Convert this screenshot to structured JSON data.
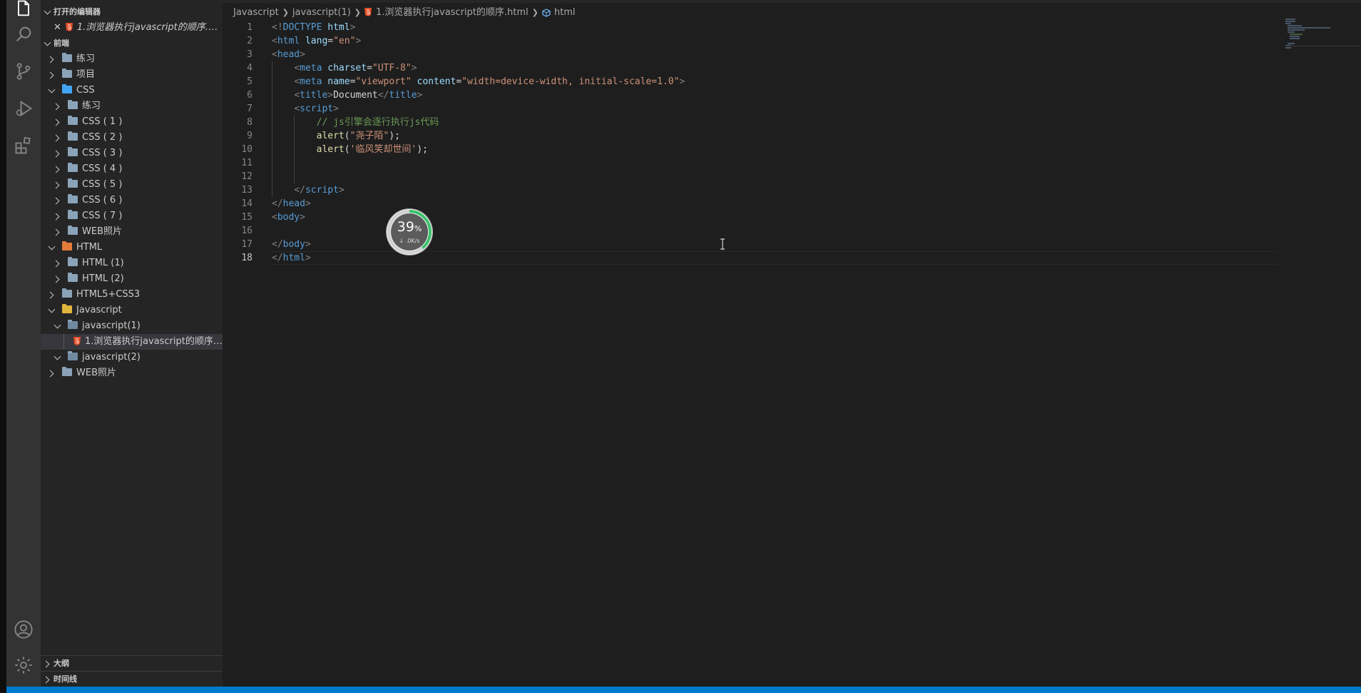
{
  "sidebar": {
    "open_editors_header": "打开的编辑器",
    "open_editor_file": "1.浏览器执行javascript的顺序.html",
    "workspace_header": "前端",
    "tree": [
      {
        "label": "练习",
        "depth": 0,
        "expanded": false,
        "kind": "folder"
      },
      {
        "label": "项目",
        "depth": 0,
        "expanded": false,
        "kind": "folder"
      },
      {
        "label": "CSS",
        "depth": 0,
        "expanded": true,
        "kind": "css"
      },
      {
        "label": "练习",
        "depth": 1,
        "expanded": false,
        "kind": "folder"
      },
      {
        "label": "CSS ( 1 )",
        "depth": 1,
        "expanded": false,
        "kind": "folder"
      },
      {
        "label": "CSS ( 2 )",
        "depth": 1,
        "expanded": false,
        "kind": "folder"
      },
      {
        "label": "CSS ( 3 )",
        "depth": 1,
        "expanded": false,
        "kind": "folder"
      },
      {
        "label": "CSS ( 4 )",
        "depth": 1,
        "expanded": false,
        "kind": "folder"
      },
      {
        "label": "CSS ( 5 )",
        "depth": 1,
        "expanded": false,
        "kind": "folder"
      },
      {
        "label": "CSS ( 6 )",
        "depth": 1,
        "expanded": false,
        "kind": "folder"
      },
      {
        "label": "CSS ( 7 )",
        "depth": 1,
        "expanded": false,
        "kind": "folder"
      },
      {
        "label": "WEB照片",
        "depth": 1,
        "expanded": false,
        "kind": "folder"
      },
      {
        "label": "HTML",
        "depth": 0,
        "expanded": true,
        "kind": "html"
      },
      {
        "label": "HTML (1)",
        "depth": 1,
        "expanded": false,
        "kind": "folder"
      },
      {
        "label": "HTML (2)",
        "depth": 1,
        "expanded": false,
        "kind": "folder"
      },
      {
        "label": "HTML5+CSS3",
        "depth": 0,
        "expanded": false,
        "kind": "folder"
      },
      {
        "label": "Javascript",
        "depth": 0,
        "expanded": true,
        "kind": "js"
      },
      {
        "label": "javascript(1)",
        "depth": 1,
        "expanded": true,
        "kind": "open"
      },
      {
        "label": "1.浏览器执行javascript的顺序.html",
        "depth": 2,
        "expanded": null,
        "kind": "html-file",
        "selected": true
      },
      {
        "label": "javascript(2)",
        "depth": 1,
        "expanded": true,
        "kind": "open"
      },
      {
        "label": "WEB照片",
        "depth": 0,
        "expanded": false,
        "kind": "folder"
      }
    ],
    "outline_header": "大纲",
    "timeline_header": "时间线"
  },
  "breadcrumb": {
    "items": [
      "Javascript",
      "javascript(1)",
      "1.浏览器执行javascript的顺序.html",
      "html"
    ]
  },
  "code": {
    "active_line": 18,
    "lines": [
      [
        {
          "t": "<!",
          "c": "br"
        },
        {
          "t": "DOCTYPE",
          "c": "tag"
        },
        {
          "t": " ",
          "c": "pl"
        },
        {
          "t": "html",
          "c": "attr"
        },
        {
          "t": ">",
          "c": "br"
        }
      ],
      [
        {
          "t": "<",
          "c": "br"
        },
        {
          "t": "html",
          "c": "tag"
        },
        {
          "t": " ",
          "c": "pl"
        },
        {
          "t": "lang",
          "c": "attr"
        },
        {
          "t": "=",
          "c": "pl"
        },
        {
          "t": "\"en\"",
          "c": "str"
        },
        {
          "t": ">",
          "c": "br"
        }
      ],
      [
        {
          "t": "<",
          "c": "br"
        },
        {
          "t": "head",
          "c": "tag"
        },
        {
          "t": ">",
          "c": "br"
        }
      ],
      [
        {
          "t": "    ",
          "c": "pl"
        },
        {
          "t": "<",
          "c": "br"
        },
        {
          "t": "meta",
          "c": "tag"
        },
        {
          "t": " ",
          "c": "pl"
        },
        {
          "t": "charset",
          "c": "attr"
        },
        {
          "t": "=",
          "c": "pl"
        },
        {
          "t": "\"UTF-8\"",
          "c": "str"
        },
        {
          "t": ">",
          "c": "br"
        }
      ],
      [
        {
          "t": "    ",
          "c": "pl"
        },
        {
          "t": "<",
          "c": "br"
        },
        {
          "t": "meta",
          "c": "tag"
        },
        {
          "t": " ",
          "c": "pl"
        },
        {
          "t": "name",
          "c": "attr"
        },
        {
          "t": "=",
          "c": "pl"
        },
        {
          "t": "\"viewport\"",
          "c": "str"
        },
        {
          "t": " ",
          "c": "pl"
        },
        {
          "t": "content",
          "c": "attr"
        },
        {
          "t": "=",
          "c": "pl"
        },
        {
          "t": "\"width=device-width, initial-scale=1.0\"",
          "c": "str"
        },
        {
          "t": ">",
          "c": "br"
        }
      ],
      [
        {
          "t": "    ",
          "c": "pl"
        },
        {
          "t": "<",
          "c": "br"
        },
        {
          "t": "title",
          "c": "tag"
        },
        {
          "t": ">",
          "c": "br"
        },
        {
          "t": "Document",
          "c": "pl"
        },
        {
          "t": "</",
          "c": "br"
        },
        {
          "t": "title",
          "c": "tag"
        },
        {
          "t": ">",
          "c": "br"
        }
      ],
      [
        {
          "t": "    ",
          "c": "pl"
        },
        {
          "t": "<",
          "c": "br"
        },
        {
          "t": "script",
          "c": "tag"
        },
        {
          "t": ">",
          "c": "br"
        }
      ],
      [
        {
          "t": "        ",
          "c": "pl"
        },
        {
          "t": "// js引擎会逐行执行js代码",
          "c": "com"
        }
      ],
      [
        {
          "t": "        ",
          "c": "pl"
        },
        {
          "t": "alert",
          "c": "fn"
        },
        {
          "t": "(",
          "c": "pl"
        },
        {
          "t": "\"尧子陌\"",
          "c": "str"
        },
        {
          "t": ");",
          "c": "pl"
        }
      ],
      [
        {
          "t": "        ",
          "c": "pl"
        },
        {
          "t": "alert",
          "c": "fn"
        },
        {
          "t": "(",
          "c": "pl"
        },
        {
          "t": "'临风笑却世间'",
          "c": "str"
        },
        {
          "t": ");",
          "c": "pl"
        }
      ],
      [],
      [],
      [
        {
          "t": "    ",
          "c": "pl"
        },
        {
          "t": "</",
          "c": "br"
        },
        {
          "t": "script",
          "c": "tag"
        },
        {
          "t": ">",
          "c": "br"
        }
      ],
      [
        {
          "t": "</",
          "c": "br"
        },
        {
          "t": "head",
          "c": "tag"
        },
        {
          "t": ">",
          "c": "br"
        }
      ],
      [
        {
          "t": "<",
          "c": "br"
        },
        {
          "t": "body",
          "c": "tag"
        },
        {
          "t": ">",
          "c": "br"
        }
      ],
      [],
      [
        {
          "t": "</",
          "c": "br"
        },
        {
          "t": "body",
          "c": "tag"
        },
        {
          "t": ">",
          "c": "br"
        }
      ],
      [
        {
          "t": "</",
          "c": "br"
        },
        {
          "t": "html",
          "c": "tag"
        },
        {
          "t": ">",
          "c": "br"
        }
      ]
    ]
  },
  "widget": {
    "percent": "39",
    "percent_sign": "%",
    "speed": "↓ .0K/s"
  },
  "colors": {
    "accent": "#007acc",
    "tag": "#569cd6",
    "string": "#ce9178",
    "comment": "#6a9955"
  }
}
